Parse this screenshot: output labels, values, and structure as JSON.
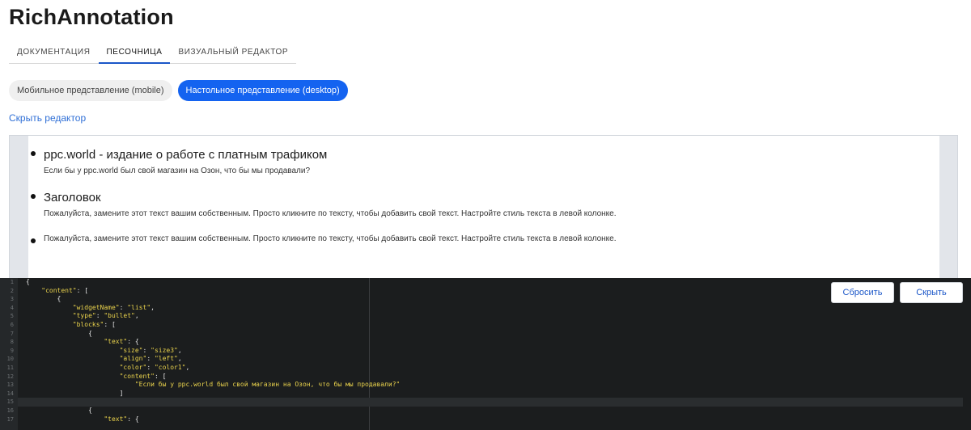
{
  "app": {
    "title": "RichAnnotation"
  },
  "tabs": [
    {
      "label": "ДОКУМЕНТАЦИЯ",
      "active": false
    },
    {
      "label": "ПЕСОЧНИЦА",
      "active": true
    },
    {
      "label": "ВИЗУАЛЬНЫЙ РЕДАКТОР",
      "active": false
    }
  ],
  "view_toggle": {
    "mobile_label": "Мобильное представление (mobile)",
    "desktop_label": "Настольное представление (desktop)",
    "selected": "desktop"
  },
  "hide_editor_link": "Скрыть редактор",
  "preview": {
    "items": [
      {
        "title": "ppc.world - издание о работе с платным трафиком",
        "text": "Если бы у ppc.world был свой магазин на Озон, что бы мы продавали?"
      },
      {
        "title": "Заголовок",
        "text": "Пожалуйста, замените этот текст вашим собственным. Просто кликните по тексту, чтобы добавить свой текст. Настройте стиль текста в левой колонке."
      },
      {
        "title": "",
        "text": "Пожалуйста, замените этот текст вашим собственным. Просто кликните по тексту, чтобы добавить свой текст. Настройте стиль текста в левой колонке."
      }
    ]
  },
  "editor": {
    "line_numbers": [
      "1",
      "2",
      "3",
      "4",
      "5",
      "6",
      "7",
      "8",
      "9",
      "10",
      "11",
      "12",
      "13",
      "14",
      "15",
      "16",
      "17"
    ],
    "code_lines": [
      "{",
      "    \"content\": [",
      "        {",
      "            \"widgetName\": \"list\",",
      "            \"type\": \"bullet\",",
      "            \"blocks\": [",
      "                {",
      "                    \"text\": {",
      "                        \"size\": \"size3\",",
      "                        \"align\": \"left\",",
      "                        \"color\": \"color1\",",
      "                        \"content\": [",
      "                            \"Если бы у ppc.world был свой магазин на Озон, что бы мы продавали?\"",
      "                        ]",
      "",
      "                {",
      "                    \"text\": {"
    ],
    "active_line": 15,
    "reset_button": "Сбросить",
    "hide_button": "Скрыть"
  },
  "colors": {
    "accent": "#1463f0",
    "link": "#2f6fd6",
    "editor_bg": "#1b1d1e",
    "code_string": "#e9d24c"
  }
}
